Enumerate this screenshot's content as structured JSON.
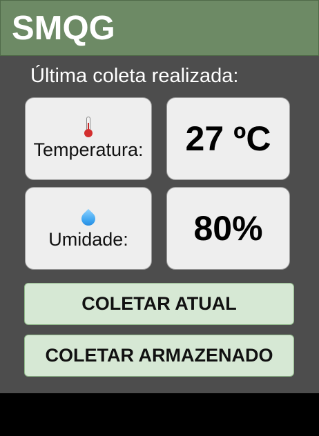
{
  "app": {
    "title": "SMQG"
  },
  "main": {
    "subtitle": "Última coleta realizada:",
    "readings": [
      {
        "label": "Temperatura:",
        "icon": "thermometer-icon",
        "value": "27 ºC"
      },
      {
        "label": "Umidade:",
        "icon": "droplet-icon",
        "value": "80%"
      }
    ],
    "buttons": {
      "collect_current": "COLETAR ATUAL",
      "collect_stored": "COLETAR ARMAZENADO"
    }
  },
  "colors": {
    "header_bg": "#6d8a65",
    "app_bg": "#4d4d4d",
    "card_bg": "#eeeeee",
    "button_bg": "#d6e8d4"
  }
}
